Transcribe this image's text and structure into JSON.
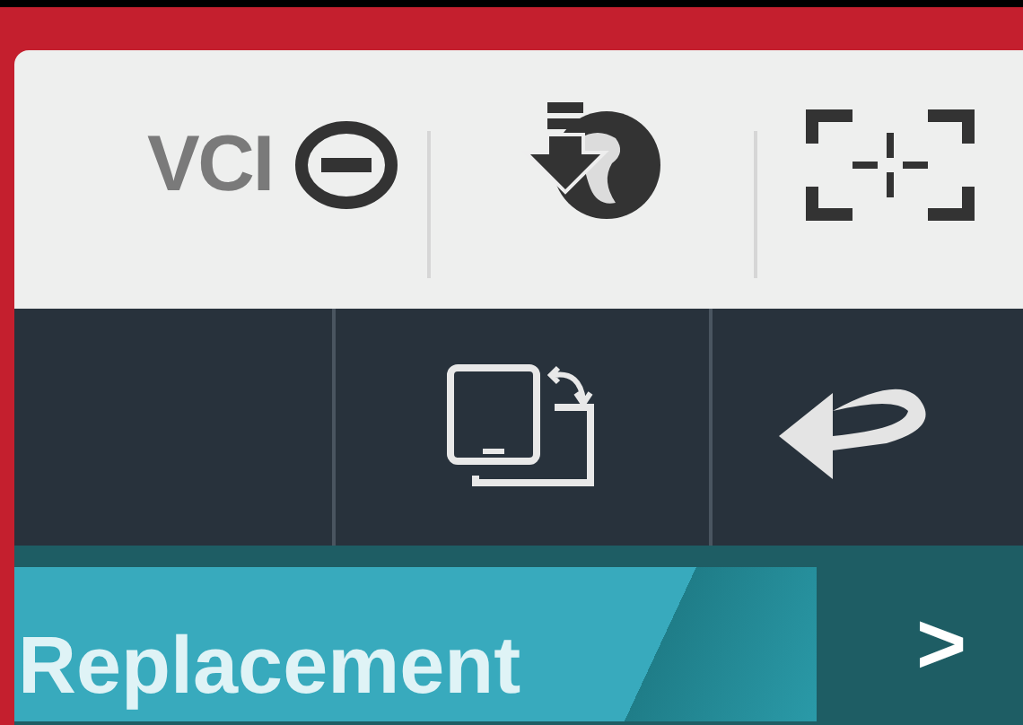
{
  "toolbar": {
    "vci_label": "VCI"
  },
  "tabs": [
    {
      "label": "Replacement",
      "selected": true
    }
  ],
  "next_button": {
    "label": ">"
  }
}
